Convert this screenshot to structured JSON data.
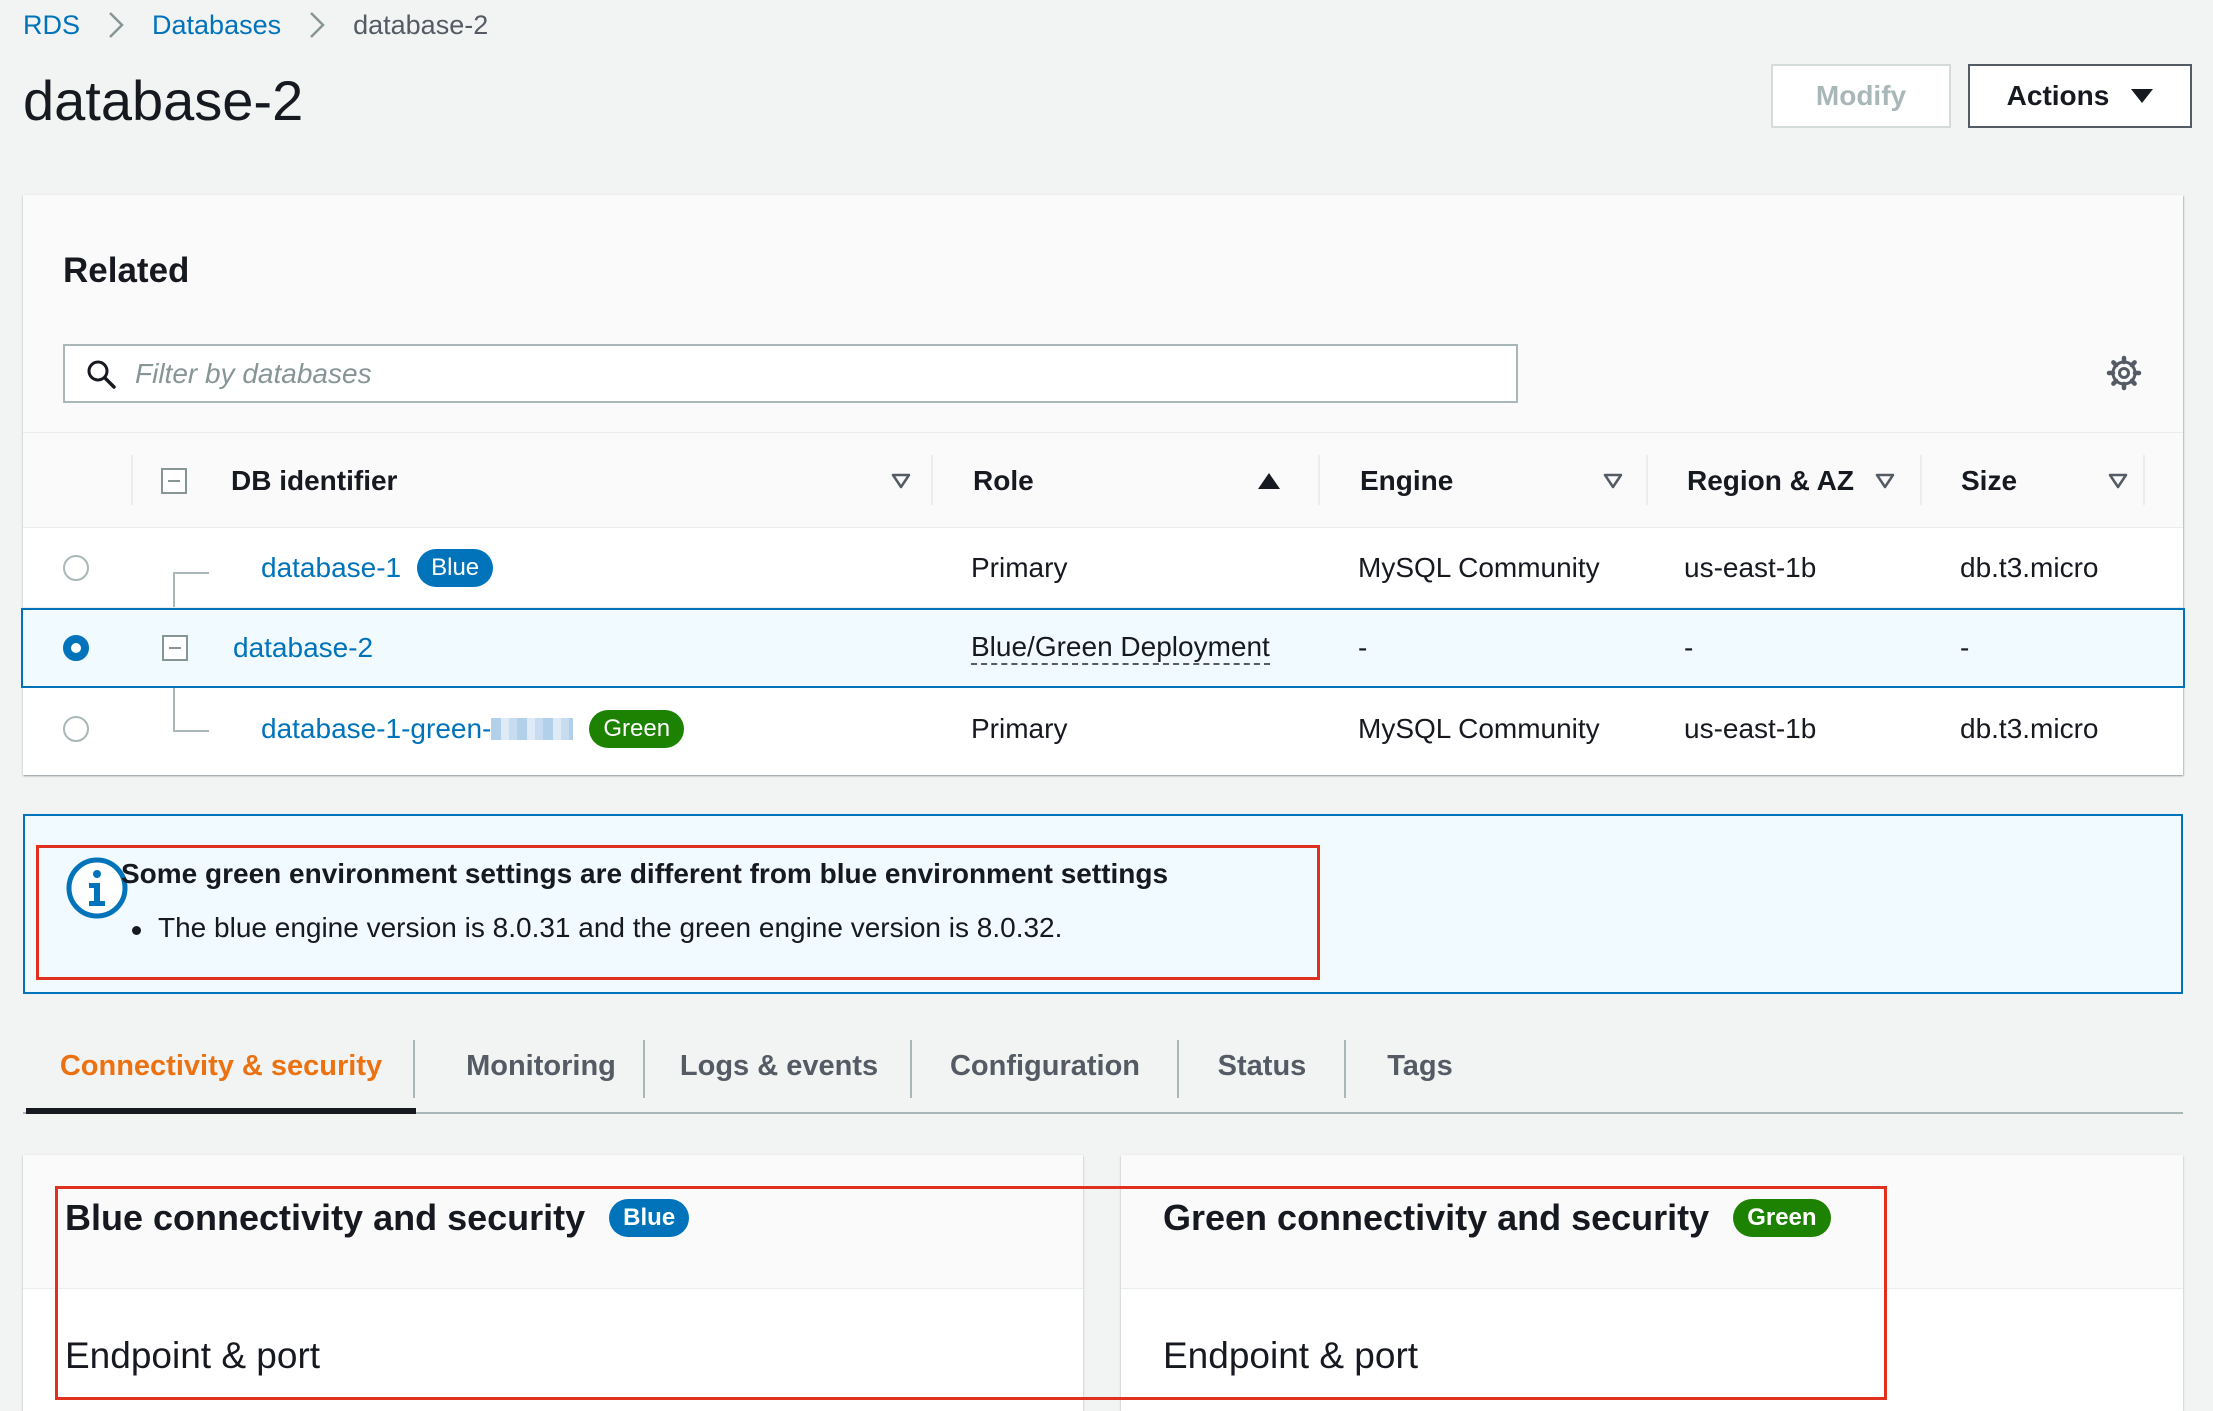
{
  "breadcrumb": {
    "root": "RDS",
    "parent": "Databases",
    "current": "database-2"
  },
  "page_title": "database-2",
  "header_buttons": {
    "modify": "Modify",
    "actions": "Actions"
  },
  "related": {
    "title": "Related",
    "filter_placeholder": "Filter by databases",
    "columns": {
      "db_identifier": "DB identifier",
      "role": "Role",
      "engine": "Engine",
      "region_az": "Region & AZ",
      "size": "Size"
    },
    "rows": [
      {
        "id": "database-1",
        "badge": "Blue",
        "role": "Primary",
        "engine": "MySQL Community",
        "region": "us-east-1b",
        "size": "db.t3.micro"
      },
      {
        "id": "database-2",
        "role": "Blue/Green Deployment",
        "engine": "-",
        "region": "-",
        "size": "-"
      },
      {
        "id": "database-1-green-",
        "badge": "Green",
        "role": "Primary",
        "engine": "MySQL Community",
        "region": "us-east-1b",
        "size": "db.t3.micro"
      }
    ]
  },
  "alert": {
    "title": "Some green environment settings are different from blue environment settings",
    "bullet": "The blue engine version is 8.0.31 and the green engine version is 8.0.32."
  },
  "tabs": [
    "Connectivity & security",
    "Monitoring",
    "Logs & events",
    "Configuration",
    "Status",
    "Tags"
  ],
  "blue_panel": {
    "title": "Blue connectivity and security",
    "badge": "Blue",
    "subtitle": "Endpoint & port"
  },
  "green_panel": {
    "title": "Green connectivity and security",
    "badge": "Green",
    "subtitle": "Endpoint & port"
  },
  "colors": {
    "link": "#0073bb",
    "blue_badge": "#0073bb",
    "green_badge": "#1d8102",
    "active_tab": "#ec7211",
    "highlight_border": "#e0301e"
  },
  "icons": {
    "search": "search-icon",
    "settings": "gear-icon",
    "info": "info-icon"
  }
}
